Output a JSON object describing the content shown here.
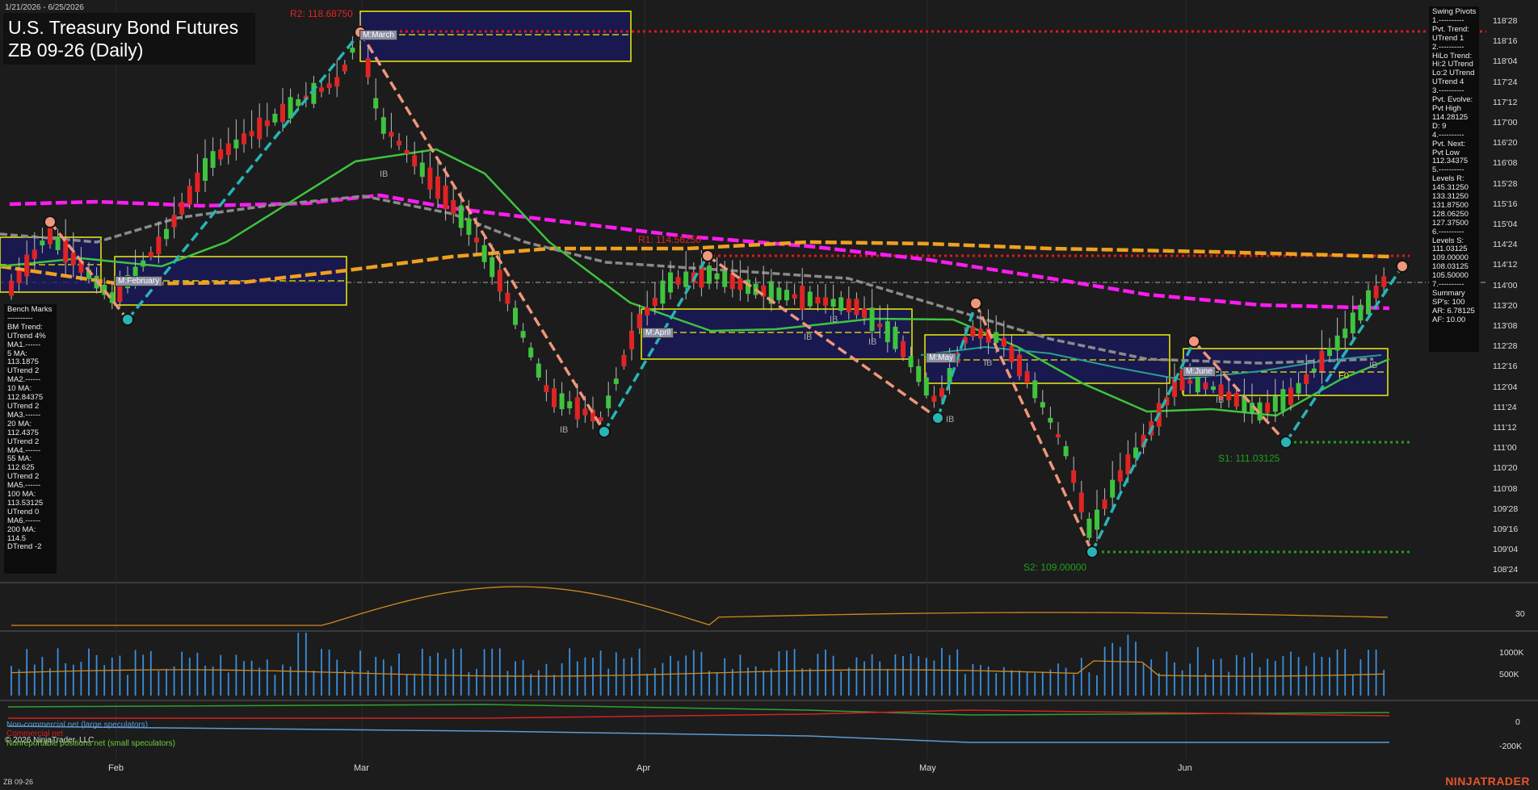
{
  "header": {
    "date_range": "1/21/2026 - 6/25/2026",
    "title_line1": "U.S. Treasury Bond Futures",
    "title_line2": "ZB 09-26 (Daily)"
  },
  "price_axis": [
    "118'28",
    "118'16",
    "118'04",
    "117'24",
    "117'12",
    "117'00",
    "116'20",
    "116'08",
    "115'28",
    "115'16",
    "115'04",
    "114'24",
    "114'12",
    "114'00",
    "113'20",
    "113'08",
    "112'28",
    "112'16",
    "112'04",
    "111'24",
    "111'12",
    "111'00",
    "110'20",
    "110'08",
    "109'28",
    "109'16",
    "109'04",
    "108'24"
  ],
  "months": [
    "Feb",
    "Mar",
    "Apr",
    "May",
    "Jun"
  ],
  "levels": {
    "r2": "R2: 118.68750",
    "r1": "R1: 114.56250",
    "s1": "S1: 111.03125",
    "s2": "S2: 109.00000"
  },
  "month_tags": [
    "M:March",
    "M:February",
    "M:April",
    "M:May",
    "M:June"
  ],
  "ib_label": "IB",
  "f0_label": "F0",
  "bench_marks": [
    "Bench Marks",
    "----------",
    "BM Trend:",
    "UTrend 4%",
    "MA1.------",
    "5 MA:",
    "113.1875",
    "UTrend 2",
    "MA2.------",
    "10 MA:",
    "112.84375",
    "UTrend 2",
    "MA3.------",
    "20 MA:",
    "112.4375",
    "UTrend 2",
    "MA4.------",
    "55 MA:",
    "112.625",
    "UTrend 2",
    "MA5.------",
    "100 MA:",
    "113.53125",
    "UTrend 0",
    "MA6.------",
    "200 MA:",
    "114.5",
    "DTrend -2"
  ],
  "swing_pivots": [
    "Swing Pivots",
    "1.----------",
    "Pvt. Trend:",
    "UTrend 1",
    "2.----------",
    "HiLo Trend:",
    "Hi:2 UTrend",
    "Lo:2 UTrend",
    "UTrend 4",
    "3.----------",
    "Pvt. Evolve:",
    "Pvt High",
    "114.28125",
    "D: 9",
    "4.----------",
    "Pvt. Next:",
    "Pvt Low",
    "112.34375",
    "5.----------",
    "Levels R:",
    "145.31250",
    "133.31250",
    "131.87500",
    "128.06250",
    "127.37500",
    "6.----------",
    "Levels S:",
    "111.03125",
    "109.00000",
    "108.03125",
    "105.50000",
    "7.----------",
    "Summary",
    "SP's: 100",
    "AR: 6.78125",
    "AF: 10.00"
  ],
  "osc_axis": "30",
  "vol_axis": [
    "1000K",
    "500K"
  ],
  "cot_axis": [
    "0",
    "-200K"
  ],
  "legend": {
    "noncommercial": "Non-commercial net (large speculators)",
    "commercial": "Commercial net",
    "nonreportable": "Nonreportable positions net (small speculators)"
  },
  "copyright": "© 2026 NinjaTrader, LLC",
  "symbol": "ZB 09-26",
  "brand": "NINJATRADER",
  "colors": {
    "bg": "#1c1c1c",
    "up": "#3ec43e",
    "down": "#e02424",
    "ma_magenta": "#ff1cf0",
    "ma_orange": "#f0a020",
    "ma_gray": "#8a8a8a",
    "ma_green": "#3ec43e",
    "ma_teal": "#2a9d8f",
    "swing_up": "#28b4b4",
    "swing_down": "#f0967a",
    "resistance": "#e01818",
    "support": "#1ea01e",
    "box_fill": "#181860",
    "box_edge": "#f0f000",
    "volume": "#3a8fe0",
    "osc": "#d08a20"
  },
  "chart_data": {
    "type": "candlestick",
    "title": "ZB 09-26 (Daily)",
    "x_range": [
      "2026-01-21",
      "2026-06-25"
    ],
    "y_range": [
      108.6,
      119.0
    ],
    "swing_points": [
      {
        "date": "2026-01-29",
        "price": 114.2
      },
      {
        "date": "2026-02-04",
        "price": 113.5
      },
      {
        "date": "2026-02-27",
        "price": 118.69
      },
      {
        "date": "2026-03-31",
        "price": 111.3
      },
      {
        "date": "2026-04-09",
        "price": 114.56
      },
      {
        "date": "2026-04-30",
        "price": 111.5
      },
      {
        "date": "2026-05-05",
        "price": 113.5
      },
      {
        "date": "2026-05-20",
        "price": 109.0
      },
      {
        "date": "2026-06-03",
        "price": 112.9
      },
      {
        "date": "2026-06-13",
        "price": 111.03
      },
      {
        "date": "2026-06-24",
        "price": 114.28
      }
    ]
  }
}
